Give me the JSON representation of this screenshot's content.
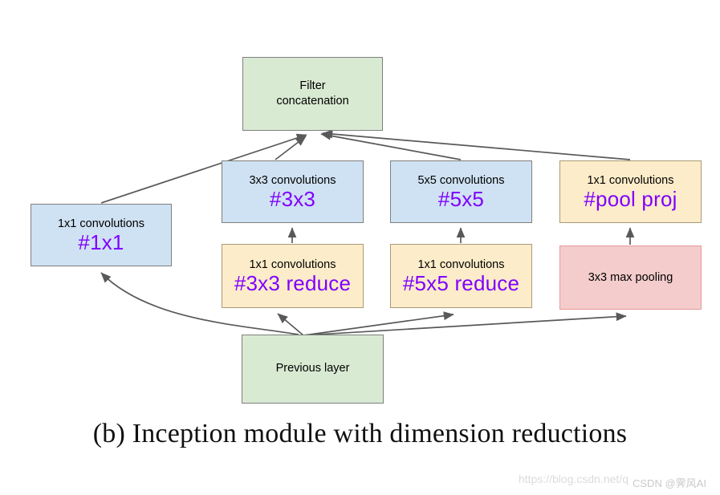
{
  "figure": {
    "caption": "(b) Inception module with dimension reductions",
    "background_color": "#ffffff",
    "edge_color": "#595959",
    "tag_color": "#8000ff",
    "title_color": "#000000"
  },
  "nodes": {
    "filter_concatenation": {
      "label": "Filter\nconcatenation",
      "fill": "#d9ead3",
      "border": "#7f7f7f"
    },
    "conv_1x1": {
      "title": "1x1 convolutions",
      "tag": "#1x1",
      "fill": "#cfe2f3",
      "border": "#7f7f7f"
    },
    "conv_3x3": {
      "title": "3x3 convolutions",
      "tag": "#3x3",
      "fill": "#cfe2f3",
      "border": "#7f7f7f"
    },
    "conv_5x5": {
      "title": "5x5 convolutions",
      "tag": "#5x5",
      "fill": "#cfe2f3",
      "border": "#7f7f7f"
    },
    "pool_proj": {
      "title": "1x1 convolutions",
      "tag": "#pool proj",
      "fill": "#fcecc9",
      "border": "#a99a76"
    },
    "reduce_3x3": {
      "title": "1x1 convolutions",
      "tag": "#3x3 reduce",
      "fill": "#fcecc9",
      "border": "#a99a76"
    },
    "reduce_5x5": {
      "title": "1x1 convolutions",
      "tag": "#5x5 reduce",
      "fill": "#fcecc9",
      "border": "#a99a76"
    },
    "max_pooling": {
      "title": "3x3 max pooling",
      "fill": "#f4cccc",
      "border": "#e89a9a"
    },
    "previous_layer": {
      "label": "Previous layer",
      "fill": "#d9ead3",
      "border": "#7f7f7f"
    }
  },
  "edges": [
    {
      "from": "previous_layer",
      "to": "conv_1x1",
      "style": "curved"
    },
    {
      "from": "previous_layer",
      "to": "reduce_3x3",
      "style": "straight"
    },
    {
      "from": "previous_layer",
      "to": "reduce_5x5",
      "style": "straight"
    },
    {
      "from": "previous_layer",
      "to": "max_pooling",
      "style": "straight"
    },
    {
      "from": "reduce_3x3",
      "to": "conv_3x3",
      "style": "straight"
    },
    {
      "from": "reduce_5x5",
      "to": "conv_5x5",
      "style": "straight"
    },
    {
      "from": "max_pooling",
      "to": "pool_proj",
      "style": "straight"
    },
    {
      "from": "conv_1x1",
      "to": "filter_concatenation",
      "style": "straight"
    },
    {
      "from": "conv_3x3",
      "to": "filter_concatenation",
      "style": "straight"
    },
    {
      "from": "conv_5x5",
      "to": "filter_concatenation",
      "style": "straight"
    },
    {
      "from": "pool_proj",
      "to": "filter_concatenation",
      "style": "straight"
    }
  ],
  "watermark": {
    "url": "https://blog.csdn.net/q",
    "brand": "CSDN @霁风AI"
  }
}
